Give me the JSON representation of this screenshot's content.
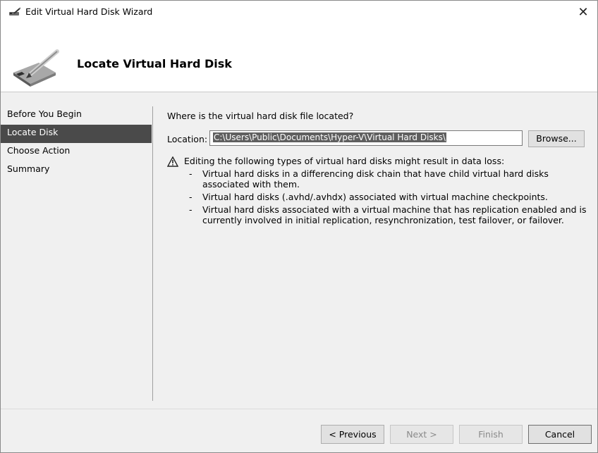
{
  "window": {
    "title": "Edit Virtual Hard Disk Wizard",
    "close_glyph": "✕",
    "icon": "disk-edit-icon"
  },
  "header": {
    "title": "Locate Virtual Hard Disk",
    "icon": "hard-disk-pencil-icon"
  },
  "nav": {
    "items": [
      {
        "label": "Before You Begin",
        "selected": false
      },
      {
        "label": "Locate Disk",
        "selected": true
      },
      {
        "label": "Choose Action",
        "selected": false
      },
      {
        "label": "Summary",
        "selected": false
      }
    ]
  },
  "main": {
    "question": "Where is the virtual hard disk file located?",
    "location_label": "Location:",
    "location_value": "C:\\Users\\Public\\Documents\\Hyper-V\\Virtual Hard Disks\\",
    "browse_label": "Browse...",
    "warning_icon": "warning-triangle-icon",
    "warning_text": "Editing the following types of virtual hard disks might result in data loss:",
    "bullets": [
      "Virtual hard disks in a differencing disk chain that have child virtual hard disks associated with them.",
      "Virtual hard disks (.avhd/.avhdx) associated with virtual machine checkpoints.",
      "Virtual hard disks associated with a virtual machine that has replication enabled and is currently involved in initial replication, resynchronization, test failover, or failover."
    ],
    "bullet_marker": "-"
  },
  "footer": {
    "previous_label": "< Previous",
    "next_label": "Next >",
    "finish_label": "Finish",
    "cancel_label": "Cancel"
  },
  "colors": {
    "selected_nav_bg": "#4a4a4a",
    "selection_highlight": "#5f5f5f"
  }
}
